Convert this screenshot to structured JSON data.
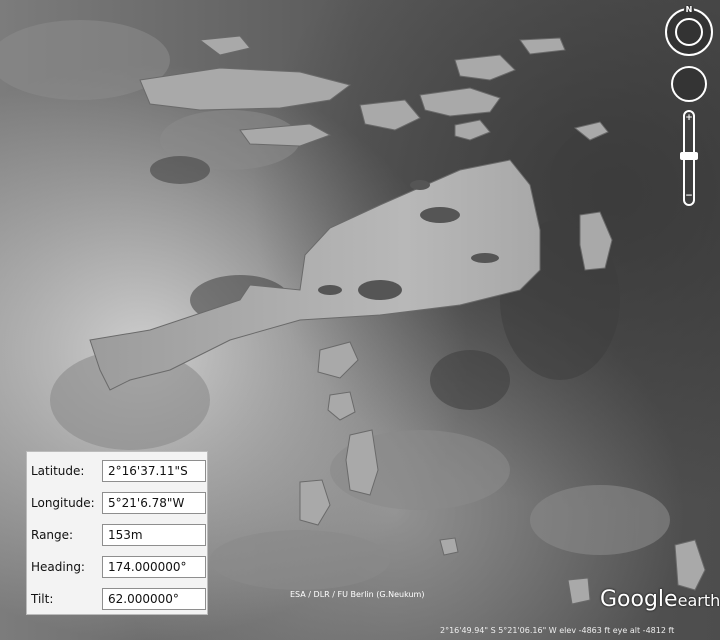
{
  "coordinates": {
    "latitude": {
      "label": "Latitude:",
      "value": "2°16'37.11\"S"
    },
    "longitude": {
      "label": "Longitude:",
      "value": "5°21'6.78\"W"
    },
    "range": {
      "label": "Range:",
      "value": "153m"
    },
    "heading": {
      "label": "Heading:",
      "value": "174.000000°"
    },
    "tilt": {
      "label": "Tilt:",
      "value": "62.000000°"
    }
  },
  "credit": "ESA / DLR / FU Berlin (G.Neukum)",
  "logo": {
    "google": "Google",
    "earth": "earth"
  },
  "nav": {
    "north_label": "N",
    "zoom_in": "+",
    "zoom_out": "−"
  },
  "status_bar": {
    "text": "2°16'49.94\" S    5°21'06.16\" W  elev -4863 ft        eye alt -4812 ft"
  },
  "colors": {
    "overlay_fill": "#a9a9a9",
    "panel_bg": "#f3f3f3"
  },
  "icons": [
    "look-ring-icon",
    "move-ring-icon",
    "zoom-slider-icon"
  ]
}
